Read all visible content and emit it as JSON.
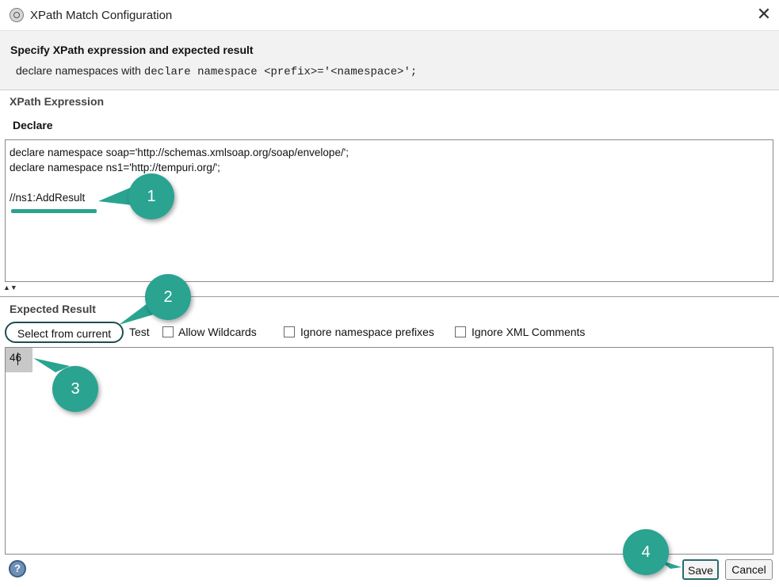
{
  "window": {
    "title": "XPath Match Configuration",
    "close_icon": "close-icon"
  },
  "header": {
    "title": "Specify XPath expression and expected result",
    "desc_prefix": "declare namespaces with",
    "desc_code": "declare namespace <prefix>='<namespace>';"
  },
  "xpath": {
    "section_label": "XPath Expression",
    "declare_button": "Declare",
    "expression": "declare namespace soap='http://schemas.xmlsoap.org/soap/envelope/';\ndeclare namespace ns1='http://tempuri.org/';\n\n//ns1:AddResult"
  },
  "expected": {
    "section_label": "Expected Result",
    "select_button": "Select from current",
    "test_button": "Test",
    "options": [
      {
        "label": "Allow Wildcards",
        "checked": false
      },
      {
        "label": "Ignore namespace prefixes",
        "checked": false
      },
      {
        "label": "Ignore XML Comments",
        "checked": false
      }
    ],
    "value": "46"
  },
  "footer": {
    "help_icon": "help-icon",
    "help_glyph": "?",
    "save_label": "Save",
    "cancel_label": "Cancel"
  },
  "callouts": [
    "1",
    "2",
    "3",
    "4"
  ],
  "colors": {
    "callout": "#2aa391",
    "callout_outline": "#1e4e52",
    "header_bg": "#f2f2f2"
  }
}
